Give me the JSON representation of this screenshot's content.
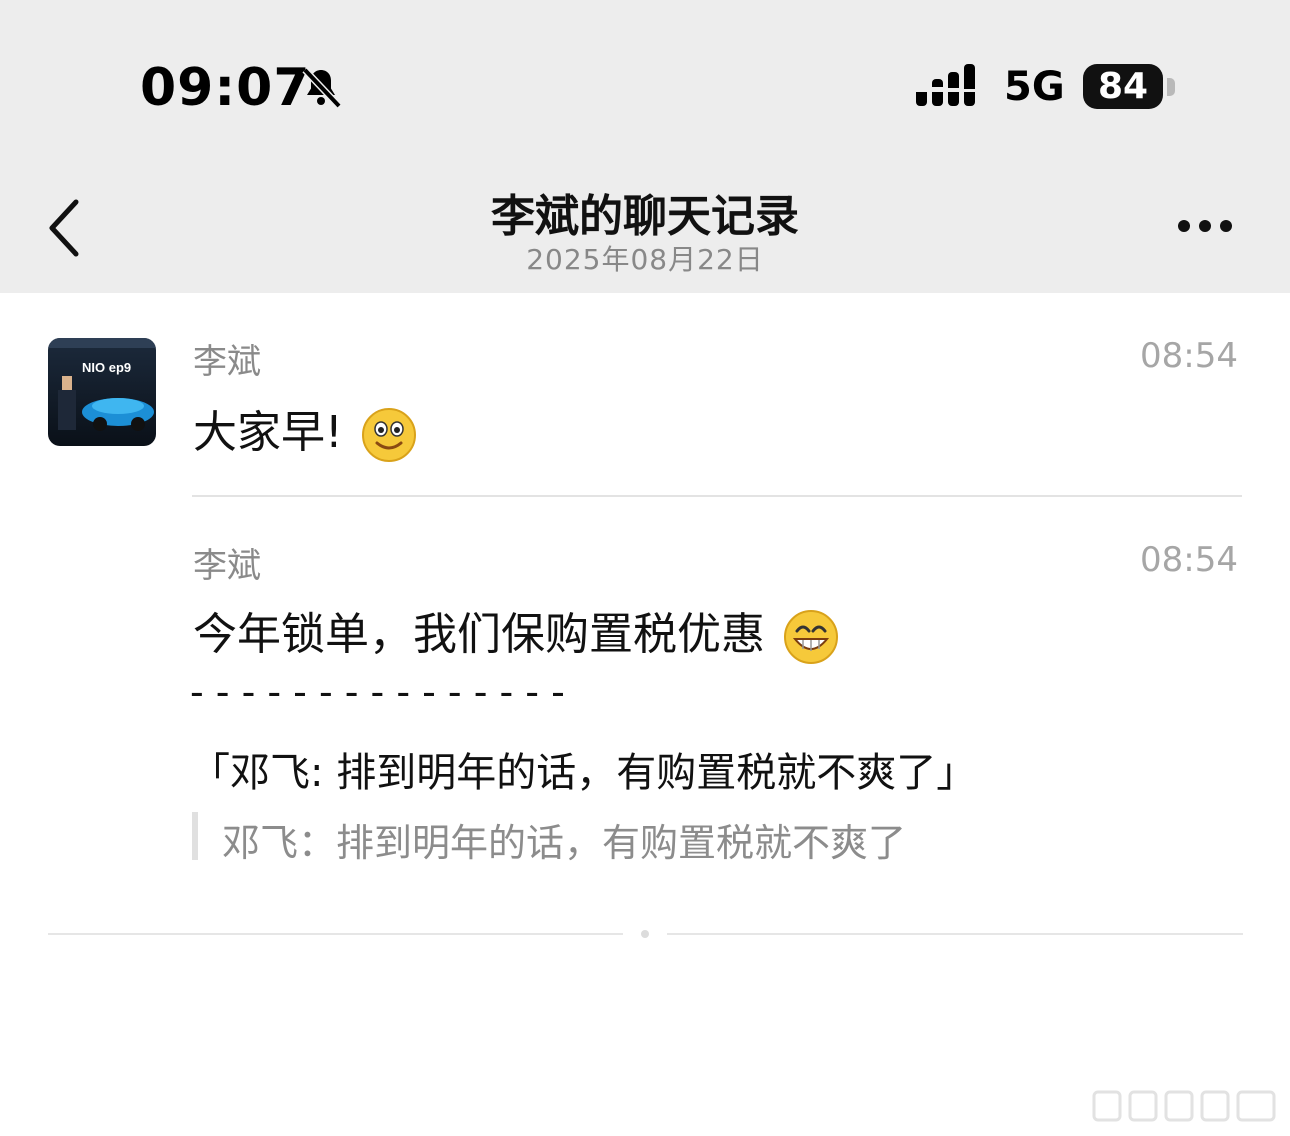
{
  "status_bar": {
    "time": "09:07",
    "network": "5G",
    "battery": "84",
    "icons": [
      "bell-slash-icon",
      "signal-icon"
    ]
  },
  "nav": {
    "title": "李斌的聊天记录",
    "date": "2025年08月22日",
    "icons": [
      "chevron-left-icon",
      "more-icon"
    ]
  },
  "messages": [
    {
      "sender": "李斌",
      "time": "08:54",
      "text": "大家早!",
      "emoji": "smile-emoji",
      "avatar_text": "NIO ep9"
    },
    {
      "sender": "李斌",
      "time": "08:54",
      "text": "今年锁单，我们保购置税优惠",
      "emoji": "grin-emoji",
      "separator": "- - - - - - - - - - - - - - -",
      "quote_full": "「邓飞: 排到明年的话，有购置税就不爽了」",
      "quote_ref": "邓飞：排到明年的话，有购置税就不爽了"
    }
  ],
  "colors": {
    "topbar_bg": "#ededed",
    "body_bg": "#ffffff",
    "muted_text": "#8a8a8a",
    "time_text": "#a6a6a6"
  }
}
